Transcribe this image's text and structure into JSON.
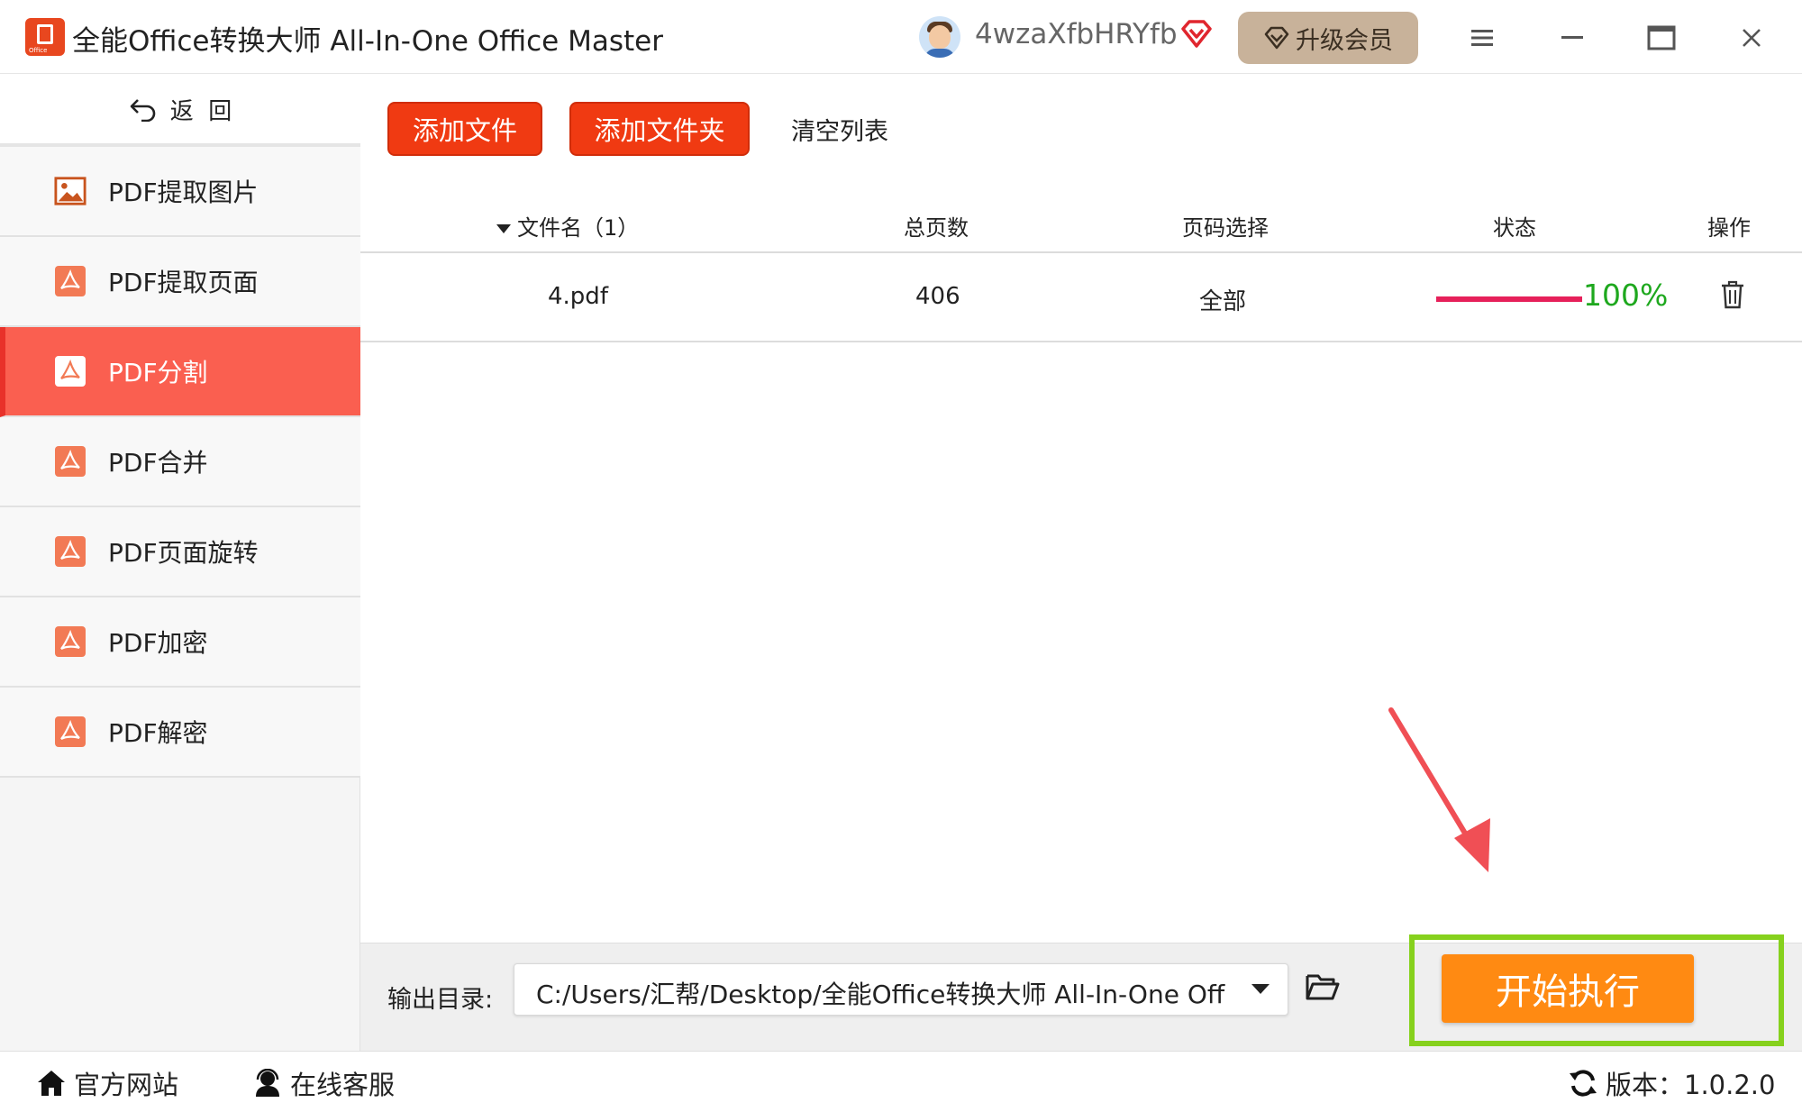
{
  "app": {
    "title": "全能Office转换大师 All-In-One Office Master",
    "logo_text": "Office",
    "username": "4wzaXfbHRYfb",
    "upgrade_label": "升级会员"
  },
  "sidebar": {
    "back_label": "返  回",
    "items": [
      {
        "label": "PDF提取图片",
        "icon": "image-icon",
        "active": false
      },
      {
        "label": "PDF提取页面",
        "icon": "pdf-icon",
        "active": false
      },
      {
        "label": "PDF分割",
        "icon": "pdf-icon",
        "active": true
      },
      {
        "label": "PDF合并",
        "icon": "pdf-icon",
        "active": false
      },
      {
        "label": "PDF页面旋转",
        "icon": "pdf-icon",
        "active": false
      },
      {
        "label": "PDF加密",
        "icon": "pdf-icon",
        "active": false
      },
      {
        "label": "PDF解密",
        "icon": "pdf-icon",
        "active": false
      }
    ]
  },
  "toolbar": {
    "add_file": "添加文件",
    "add_folder": "添加文件夹",
    "clear_list": "清空列表"
  },
  "table": {
    "headers": {
      "filename": "文件名（1）",
      "pages": "总页数",
      "page_select": "页码选择",
      "status": "状态",
      "action": "操作"
    },
    "rows": [
      {
        "filename": "4.pdf",
        "pages": "406",
        "page_select": "全部",
        "progress": 100,
        "progress_text": "100%"
      }
    ]
  },
  "output": {
    "label": "输出目录:",
    "path": "C:/Users/汇帮/Desktop/全能Office转换大师 All-In-One Off"
  },
  "start_button": "开始执行",
  "footer": {
    "website": "官方网站",
    "support": "在线客服",
    "version": "版本：1.0.2.0"
  },
  "colors": {
    "accent_red": "#f03a12",
    "active_item": "#fa5f50",
    "start_orange": "#ff8a12",
    "highlight_green": "#86d11d",
    "progress_pink": "#e6205a",
    "progress_green": "#1ea81e"
  }
}
